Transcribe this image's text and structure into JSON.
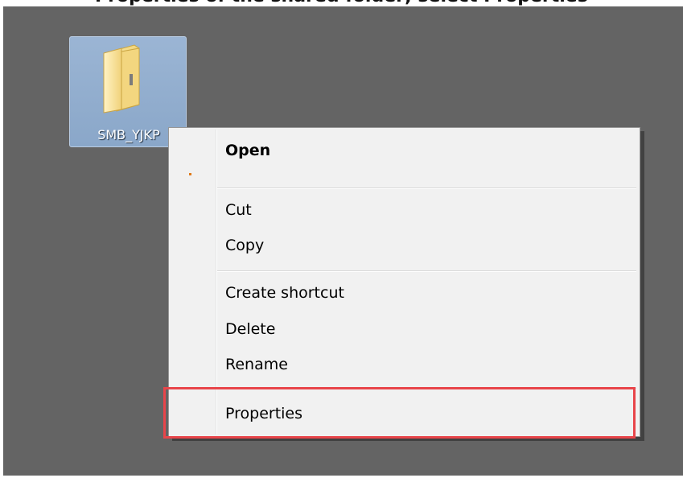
{
  "caption_text": "Properties of the shared folder; select Properties",
  "desktop": {
    "folder": {
      "name": "SMB_YJKP",
      "icon": "folder-icon"
    }
  },
  "context_menu": {
    "items": [
      {
        "label": "Open",
        "bold": true
      },
      {
        "label": "Cut"
      },
      {
        "label": "Copy"
      },
      {
        "label": "Create shortcut"
      },
      {
        "label": "Delete"
      },
      {
        "label": "Rename"
      },
      {
        "label": "Properties",
        "highlighted": true
      }
    ]
  },
  "colors": {
    "desktop_bg": "#646464",
    "menu_bg": "#f1f1f1",
    "highlight_border": "#e8454a",
    "folder_selection": "#8aa7c9"
  }
}
